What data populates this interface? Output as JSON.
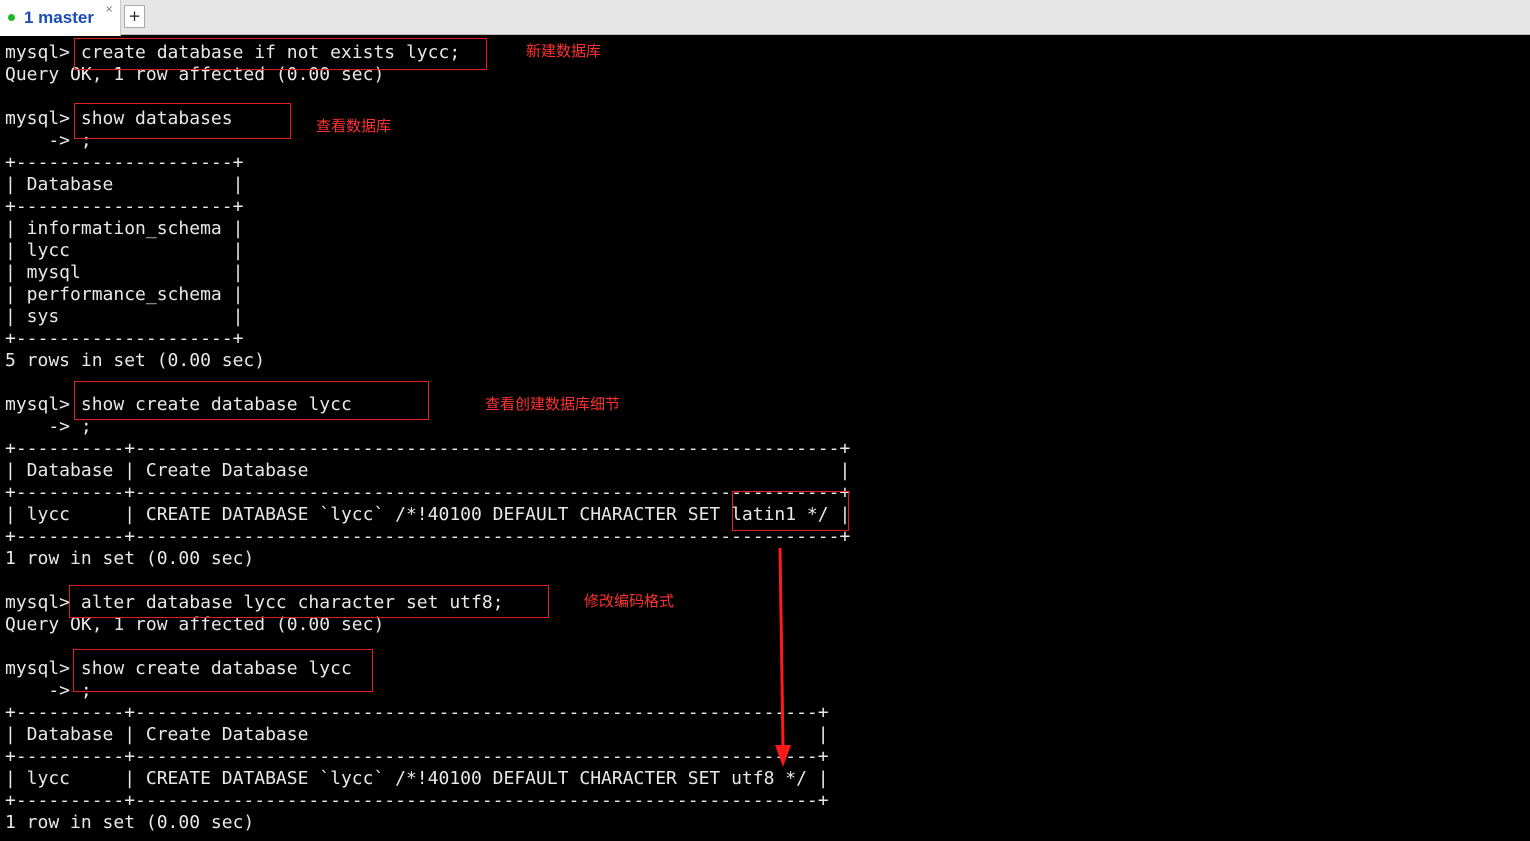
{
  "tabs": {
    "active_label": "1 master",
    "close_glyph": "×",
    "new_tab_label": "+",
    "status_color": "#1fb81f"
  },
  "terminal": {
    "lines": [
      "mysql> create database if not exists lycc;",
      "Query OK, 1 row affected (0.00 sec)",
      "",
      "mysql> show databases",
      "    -> ;",
      "+--------------------+",
      "| Database           |",
      "+--------------------+",
      "| information_schema |",
      "| lycc               |",
      "| mysql              |",
      "| performance_schema |",
      "| sys                |",
      "+--------------------+",
      "5 rows in set (0.00 sec)",
      "",
      "mysql> show create database lycc",
      "    -> ;",
      "+----------+-----------------------------------------------------------------+",
      "| Database | Create Database                                                 |",
      "+----------+-----------------------------------------------------------------+",
      "| lycc     | CREATE DATABASE `lycc` /*!40100 DEFAULT CHARACTER SET latin1 */ |",
      "+----------+-----------------------------------------------------------------+",
      "1 row in set (0.00 sec)",
      "",
      "mysql> alter database lycc character set utf8;",
      "Query OK, 1 row affected (0.00 sec)",
      "",
      "mysql> show create database lycc",
      "    -> ;",
      "+----------+---------------------------------------------------------------+",
      "| Database | Create Database                                               |",
      "+----------+---------------------------------------------------------------+",
      "| lycc     | CREATE DATABASE `lycc` /*!40100 DEFAULT CHARACTER SET utf8 */ |",
      "+----------+---------------------------------------------------------------+",
      "1 row in set (0.00 sec)"
    ]
  },
  "annotations": {
    "create_db": "新建数据库",
    "show_dbs": "查看数据库",
    "show_create": "查看创建数据库细节",
    "alter_charset": "修改编码格式"
  },
  "colors": {
    "annotation": "#ff3030",
    "terminal_bg": "#000000",
    "terminal_fg": "#e8e8e8"
  }
}
